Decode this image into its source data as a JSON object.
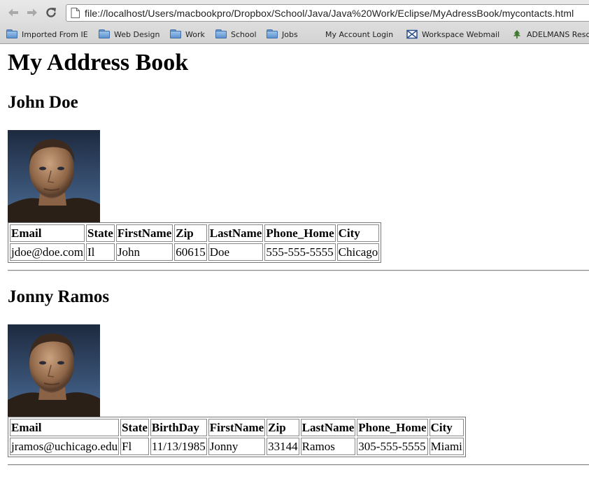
{
  "browser": {
    "url": "file://localhost/Users/macbookpro/Dropbox/School/Java/Java%20Work/Eclipse/MyAdressBook/mycontacts.html",
    "bookmarks": [
      {
        "label": "Imported From IE",
        "icon": "folder-icon"
      },
      {
        "label": "Web Design",
        "icon": "folder-icon"
      },
      {
        "label": "Work",
        "icon": "folder-icon"
      },
      {
        "label": "School",
        "icon": "folder-icon"
      },
      {
        "label": "Jobs",
        "icon": "folder-icon"
      },
      {
        "label": "My Account Login",
        "icon": ""
      },
      {
        "label": "Workspace Webmail",
        "icon": "mail-icon"
      },
      {
        "label": "ADELMANS Reso",
        "icon": "tree-icon"
      }
    ]
  },
  "page": {
    "title": "My Address Book",
    "contacts": [
      {
        "name": "John Doe",
        "photo_icon": "portrait-photo",
        "headers": [
          "Email",
          "State",
          "FirstName",
          "Zip",
          "LastName",
          "Phone_Home",
          "City"
        ],
        "values": [
          "jdoe@doe.com",
          "Il",
          "John",
          "60615",
          "Doe",
          "555-555-5555",
          "Chicago"
        ]
      },
      {
        "name": "Jonny Ramos",
        "photo_icon": "portrait-photo",
        "headers": [
          "Email",
          "State",
          "BirthDay",
          "FirstName",
          "Zip",
          "LastName",
          "Phone_Home",
          "City"
        ],
        "values": [
          "jramos@uchicago.edu",
          "Fl",
          "11/13/1985",
          "Jonny",
          "33144",
          "Ramos",
          "305-555-5555",
          "Miami"
        ]
      }
    ]
  }
}
